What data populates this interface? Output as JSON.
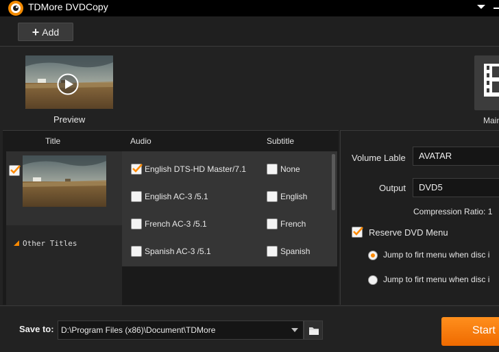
{
  "app": {
    "title": "TDMore DVDCopy"
  },
  "toolbar": {
    "add_label": "Add"
  },
  "preview": {
    "label": "Preview"
  },
  "mode": {
    "label": "Main"
  },
  "table": {
    "headers": {
      "title": "Title",
      "audio": "Audio",
      "subtitle": "Subtitle"
    },
    "title_checked": true,
    "other_titles_label": "Other Titles",
    "audio_tracks": [
      {
        "label": "English DTS-HD Master/7.1",
        "checked": true
      },
      {
        "label": "English AC-3 /5.1",
        "checked": false
      },
      {
        "label": "French AC-3 /5.1",
        "checked": false
      },
      {
        "label": "Spanish AC-3 /5.1",
        "checked": false
      }
    ],
    "subtitles": [
      {
        "label": "None",
        "checked": false
      },
      {
        "label": "English",
        "checked": false
      },
      {
        "label": "French",
        "checked": false
      },
      {
        "label": "Spanish",
        "checked": false
      }
    ]
  },
  "settings": {
    "volume_label": "Volume Lable",
    "volume_value": "AVATAR",
    "output_label": "Output",
    "output_value": "DVD5",
    "compression_text": "Compression Ratio: 1",
    "reserve_menu_label": "Reserve DVD Menu",
    "reserve_menu_checked": true,
    "radio_options": [
      {
        "label": "Jump to firt menu when disc i",
        "selected": true
      },
      {
        "label": "Jump to firt menu when disc i",
        "selected": false
      }
    ]
  },
  "footer": {
    "save_label": "Save to:",
    "save_path": "D:\\Program Files (x86)\\Document\\TDMore",
    "start_label": "Start"
  },
  "colors": {
    "accent": "#ff8a00",
    "panel": "#353535",
    "background": "#1a1a1a"
  }
}
